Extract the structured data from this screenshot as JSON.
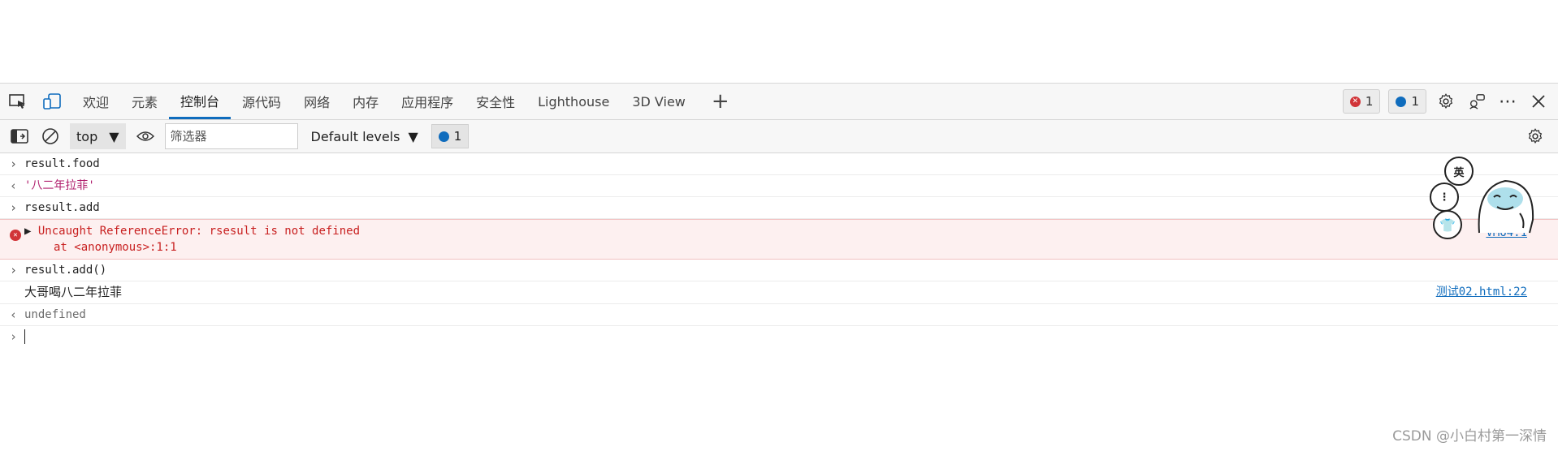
{
  "tabbar": {
    "tabs": [
      "欢迎",
      "元素",
      "控制台",
      "源代码",
      "网络",
      "内存",
      "应用程序",
      "安全性",
      "Lighthouse",
      "3D View"
    ],
    "active_tab": "控制台",
    "error_count": "1",
    "message_count": "1"
  },
  "toolbar": {
    "context": "top",
    "filter_placeholder": "筛选器",
    "levels": "Default levels",
    "message_count": "1"
  },
  "console": {
    "entries": [
      {
        "kind": "input",
        "text": "result.food"
      },
      {
        "kind": "result",
        "text": "'八二年拉菲'"
      },
      {
        "kind": "input",
        "text": "rsesult.add"
      },
      {
        "kind": "error",
        "line1": "Uncaught ReferenceError: rsesult is not defined",
        "line2": "at <anonymous>:1:1",
        "source": "VM64:1"
      },
      {
        "kind": "input",
        "text": "result.add()"
      },
      {
        "kind": "log",
        "text": "大哥喝八二年拉菲",
        "source": "测试02.html:22"
      },
      {
        "kind": "result",
        "text": "undefined"
      }
    ]
  },
  "sticker": {
    "label": "英"
  },
  "watermark": "CSDN @小白村第一深情"
}
